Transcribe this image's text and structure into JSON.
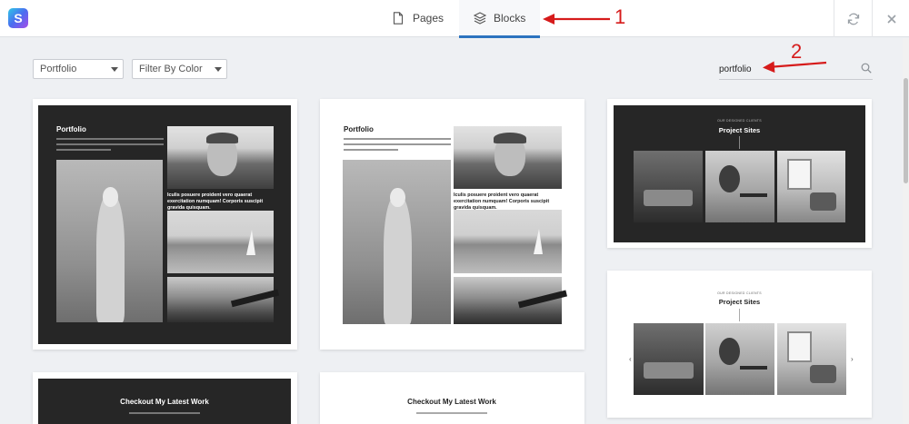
{
  "app": {
    "logo_icon": "s-logo-icon"
  },
  "tabs": [
    {
      "label": "Pages",
      "icon": "page-icon",
      "active": false
    },
    {
      "label": "Blocks",
      "icon": "layers-icon",
      "active": true
    }
  ],
  "toolbar": {
    "refresh_icon": "refresh-icon",
    "close_icon": "close-icon"
  },
  "annotations": {
    "one": "1",
    "two": "2",
    "color": "#d61b1b"
  },
  "filters": {
    "category": {
      "selected": "Portfolio",
      "icon": "chevron-down-icon"
    },
    "color": {
      "selected": "Filter By Color",
      "icon": "chevron-down-icon"
    }
  },
  "search": {
    "value": "portfolio",
    "icon": "search-icon"
  },
  "cards": {
    "portfolio_dark": {
      "title": "Portfolio",
      "caption": "Iculis posuere proident vero quaerat exercitation numquam! Corporis suscipit gravida quisquam."
    },
    "portfolio_light": {
      "title": "Portfolio",
      "caption": "Iculis posuere proident vero quaerat exercitation numquam! Corporis suscipit gravida quisquam."
    },
    "project_dark": {
      "eyebrow": "OUR DESIGNED CLIENTS",
      "title": "Project Sites"
    },
    "project_light": {
      "eyebrow": "OUR DESIGNED CLIENTS",
      "title": "Project Sites",
      "prev": "‹",
      "next": "›"
    },
    "latest_dark": {
      "title": "Checkout My Latest Work"
    },
    "latest_light": {
      "title": "Checkout My Latest Work"
    }
  },
  "colors": {
    "accent": "#2b73bf",
    "dark_block": "#262626",
    "background": "#eef0f3"
  }
}
